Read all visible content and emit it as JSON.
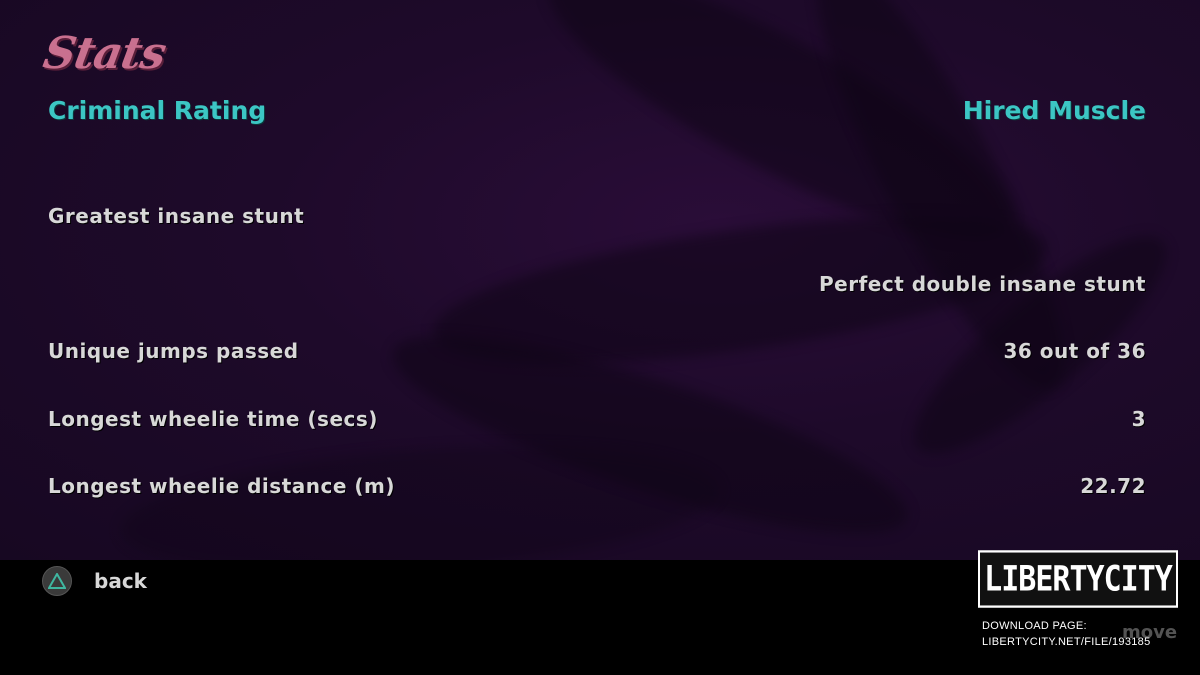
{
  "title": "Stats",
  "criminal_rating": {
    "label": "Criminal Rating",
    "value": "Hired Muscle"
  },
  "stats": [
    {
      "label": "Greatest insane stunt",
      "value": ""
    },
    {
      "label": "",
      "value": "Perfect double insane stunt"
    },
    {
      "label": "Unique jumps passed",
      "value": "36 out of 36"
    },
    {
      "label": "Longest wheelie time (secs)",
      "value": "3"
    },
    {
      "label": "Longest wheelie distance (m)",
      "value": "22.72"
    }
  ],
  "footer": {
    "back_label": "back",
    "move_label": "move"
  },
  "watermark": {
    "logo_text": "LIBERTYCITY",
    "line1": "DOWNLOAD PAGE:",
    "line2": "LIBERTYCITY.NET/FILE/193185"
  },
  "colors": {
    "title": "#c9708f",
    "rating": "#3cc6c4",
    "text": "#d8d8d8",
    "background": "#1e0a2a"
  }
}
